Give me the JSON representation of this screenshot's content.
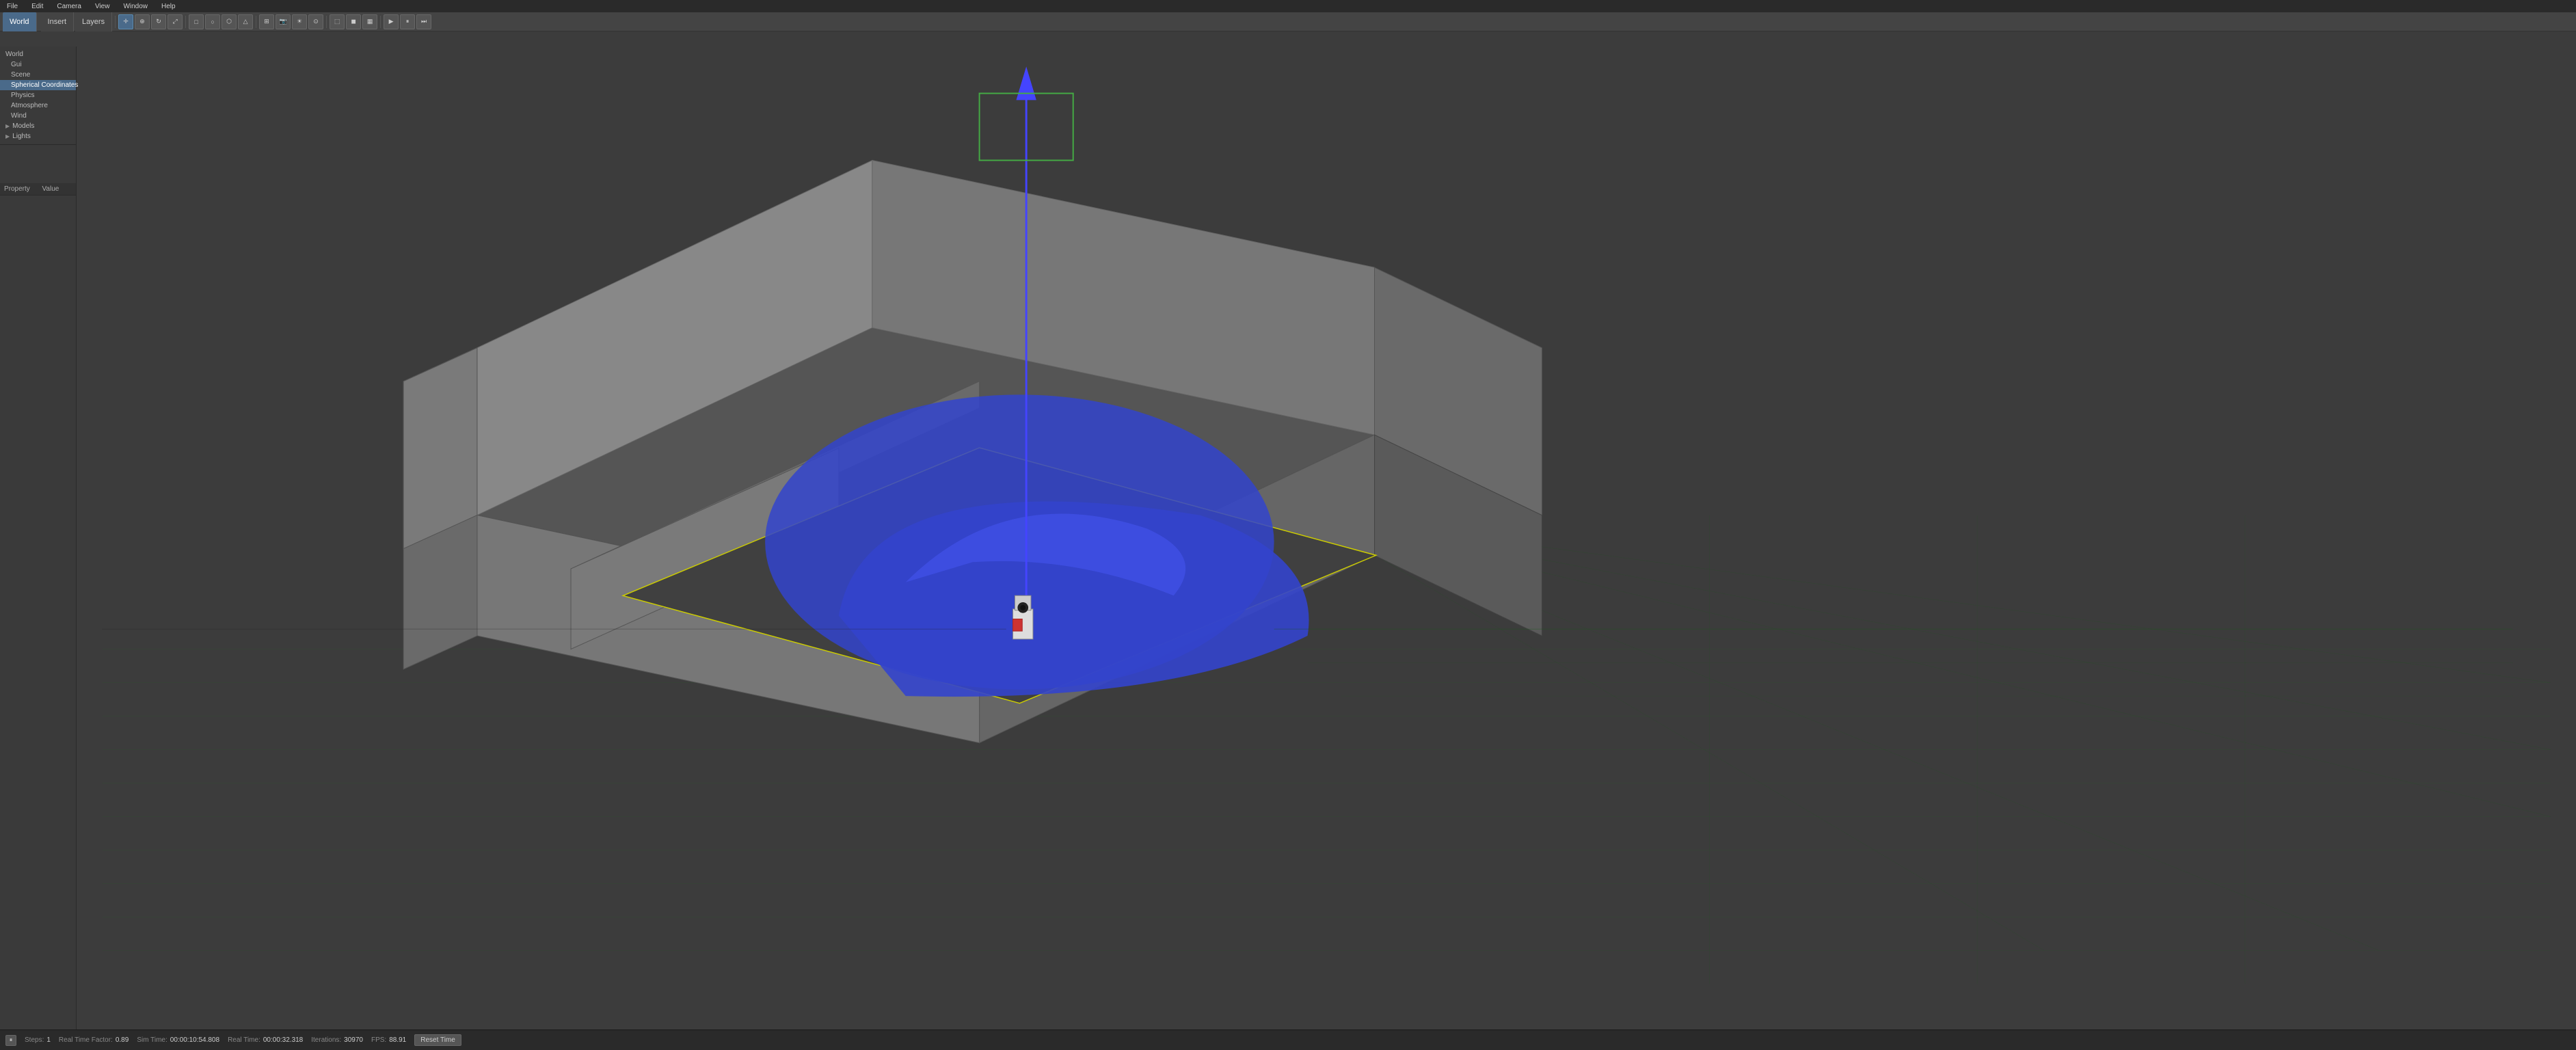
{
  "menubar": {
    "items": [
      "File",
      "Edit",
      "Camera",
      "View",
      "Window",
      "Help"
    ]
  },
  "toolbar": {
    "tabs": [
      "Insert",
      "Layers"
    ],
    "active_tab": "Insert",
    "world_tab": "World"
  },
  "sidebar": {
    "tree_items": [
      {
        "label": "World",
        "level": 0,
        "selected": false,
        "has_arrow": false
      },
      {
        "label": "Gui",
        "level": 1,
        "selected": false,
        "has_arrow": false
      },
      {
        "label": "Scene",
        "level": 1,
        "selected": false,
        "has_arrow": false
      },
      {
        "label": "Spherical Coordinates",
        "level": 1,
        "selected": true,
        "has_arrow": false
      },
      {
        "label": "Physics",
        "level": 1,
        "selected": false,
        "has_arrow": false
      },
      {
        "label": "Atmosphere",
        "level": 1,
        "selected": false,
        "has_arrow": false
      },
      {
        "label": "Wind",
        "level": 1,
        "selected": false,
        "has_arrow": false
      },
      {
        "label": "Models",
        "level": 0,
        "selected": false,
        "has_arrow": true
      },
      {
        "label": "Lights",
        "level": 0,
        "selected": false,
        "has_arrow": true
      }
    ],
    "properties_header": [
      "Property",
      "Value"
    ]
  },
  "status_bar": {
    "pause_icon": "⏸",
    "steps_label": "Steps:",
    "steps_value": "1",
    "realtime_factor_label": "Real Time Factor:",
    "realtime_factor_value": "0.89",
    "sim_time_label": "Sim Time:",
    "sim_time_value": "00:00:10:54.808",
    "real_time_label": "Real Time:",
    "real_time_value": "00:00:32.318",
    "iterations_label": "Iterations:",
    "iterations_value": "30970",
    "fps_label": "FPS:",
    "fps_value": "88.91",
    "reset_time_label": "Reset Time"
  },
  "viewport": {
    "background_color": "#3c3c3c",
    "grid_color": "#2a5a2a",
    "axis_blue": "#4444ff",
    "selection_color": "#aaaa00",
    "building_color": "#9a9a9a",
    "dome_color": "#3333cc"
  }
}
